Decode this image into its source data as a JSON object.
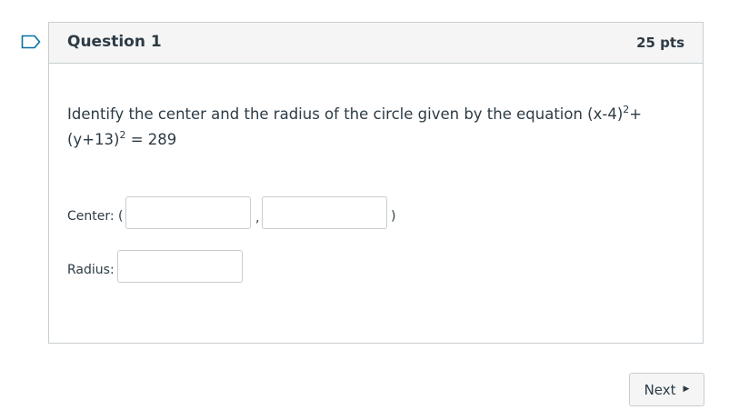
{
  "question": {
    "title": "Question 1",
    "points": "25 pts",
    "text_parts": {
      "p1": "Identify the center and the radius of the circle given by the equation (x-4)",
      "sup1": "2",
      "p2": "+(y+13)",
      "sup2": "2",
      "p3": " = 289"
    },
    "center": {
      "label": "Center: (",
      "separator": ",",
      "close": ")",
      "x_value": "",
      "y_value": ""
    },
    "radius": {
      "label": "Radius:",
      "value": ""
    }
  },
  "navigation": {
    "next_label": "Next",
    "next_icon": "caret-right-icon"
  },
  "icons": {
    "flag": "flag-icon"
  },
  "colors": {
    "text": "#2d3b45",
    "border": "#c7cdd1",
    "header_bg": "#f5f5f5",
    "flag": "#0770a3"
  }
}
